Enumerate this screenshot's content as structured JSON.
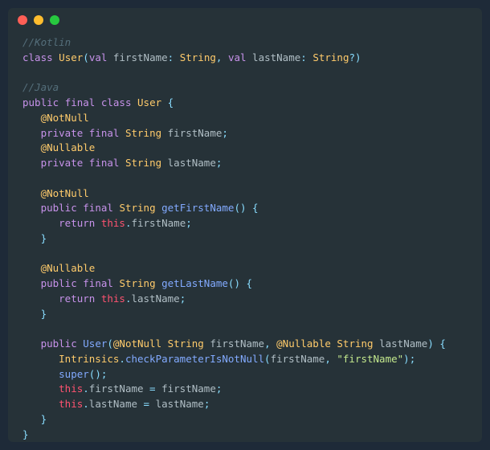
{
  "window": {
    "buttons": [
      "close",
      "minimize",
      "zoom"
    ]
  },
  "code": {
    "comment_kotlin": "//Kotlin",
    "kotlin_line": {
      "kw_class": "class",
      "type_user": "User",
      "p_open": "(",
      "kw_val1": "val",
      "id_firstName": "firstName",
      "colon1": ": ",
      "type_string1": "String",
      "comma1": ", ",
      "kw_val2": "val",
      "id_lastName": "lastName",
      "colon2": ": ",
      "type_string2": "String",
      "q": "?",
      "p_close": ")"
    },
    "comment_java": "//Java",
    "java": {
      "l1": {
        "kw_public": "public",
        "kw_final": "final",
        "kw_class": "class",
        "type_user": "User",
        "brace": " {"
      },
      "l2": {
        "anno": "@NotNull"
      },
      "l3": {
        "kw_private": "private",
        "kw_final": "final",
        "type": "String",
        "id": "firstName",
        "semi": ";"
      },
      "l4": {
        "anno": "@Nullable"
      },
      "l5": {
        "kw_private": "private",
        "kw_final": "final",
        "type": "String",
        "id": "lastName",
        "semi": ";"
      },
      "l6": {
        "anno": "@NotNull"
      },
      "l7": {
        "kw_public": "public",
        "kw_final": "final",
        "type": "String",
        "fn": "getFirstName",
        "parens": "()",
        "brace": " {"
      },
      "l8": {
        "kw_return": "return",
        "kw_this": "this",
        "dot": ".",
        "id": "firstName",
        "semi": ";"
      },
      "l9": {
        "brace": "}"
      },
      "l10": {
        "anno": "@Nullable"
      },
      "l11": {
        "kw_public": "public",
        "kw_final": "final",
        "type": "String",
        "fn": "getLastName",
        "parens": "()",
        "brace": " {"
      },
      "l12": {
        "kw_return": "return",
        "kw_this": "this",
        "dot": ".",
        "id": "lastName",
        "semi": ";"
      },
      "l13": {
        "brace": "}"
      },
      "l14": {
        "kw_public": "public",
        "fn": "User",
        "p_open": "(",
        "anno1": "@NotNull",
        "type1": "String",
        "id1": "firstName",
        "comma": ", ",
        "anno2": "@Nullable",
        "type2": "String",
        "id2": "lastName",
        "p_close": ")",
        "brace": " {"
      },
      "l15": {
        "cls": "Intrinsics",
        "dot": ".",
        "fn": "checkParameterIsNotNull",
        "p_open": "(",
        "id": "firstName",
        "comma": ", ",
        "str": "\"firstName\"",
        "p_close": ")",
        "semi": ";"
      },
      "l16": {
        "fn": "super",
        "parens": "()",
        "semi": ";"
      },
      "l17": {
        "kw_this": "this",
        "dot": ".",
        "id1": "firstName",
        "eq": " = ",
        "id2": "firstName",
        "semi": ";"
      },
      "l18": {
        "kw_this": "this",
        "dot": ".",
        "id1": "lastName",
        "eq": " = ",
        "id2": "lastName",
        "semi": ";"
      },
      "l19": {
        "brace": "}"
      },
      "l20": {
        "brace": "}"
      }
    }
  }
}
